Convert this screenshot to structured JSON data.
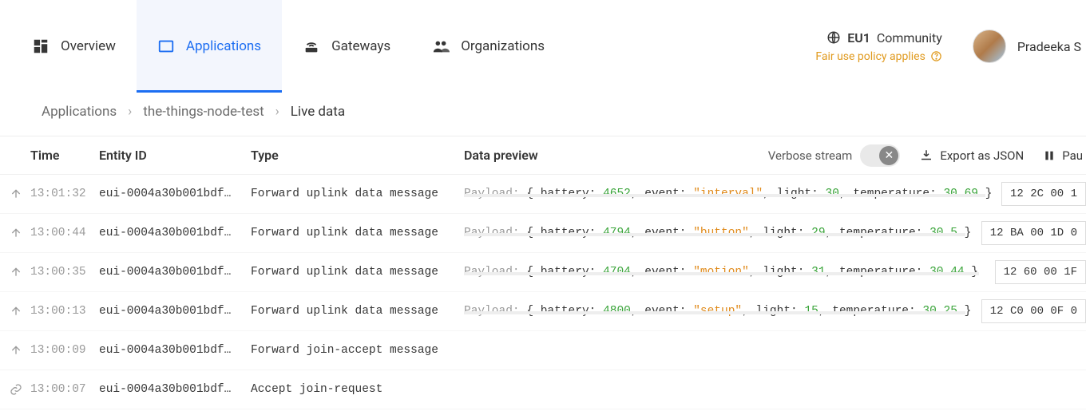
{
  "nav": {
    "overview": "Overview",
    "applications": "Applications",
    "gateways": "Gateways",
    "organizations": "Organizations"
  },
  "cluster": {
    "name": "EU1",
    "tag": "Community",
    "policy": "Fair use policy applies"
  },
  "user": {
    "name": "Pradeeka S"
  },
  "breadcrumb": {
    "root": "Applications",
    "app": "the-things-node-test",
    "page": "Live data"
  },
  "columns": {
    "time": "Time",
    "entity": "Entity ID",
    "type": "Type",
    "preview": "Data preview"
  },
  "controls": {
    "verbose": "Verbose stream",
    "export": "Export as JSON",
    "pause": "Pau"
  },
  "payload_label": "Payload:",
  "payload_keys": {
    "battery": "battery",
    "event": "event",
    "light": "light",
    "temperature": "temperature"
  },
  "entity_trunc": "eui-0004a30b001bdf…",
  "rows": [
    {
      "icon": "up",
      "time": "13:01:32",
      "type": "Forward uplink data message",
      "has_payload": true,
      "battery": "4652",
      "event": "\"interval\"",
      "light": "30",
      "temperature": "30.69",
      "hex": "12 2C 00 1"
    },
    {
      "icon": "up",
      "time": "13:00:44",
      "type": "Forward uplink data message",
      "has_payload": true,
      "battery": "4794",
      "event": "\"button\"",
      "light": "29",
      "temperature": "30.5",
      "hex": "12 BA 00 1D 0"
    },
    {
      "icon": "up",
      "time": "13:00:35",
      "type": "Forward uplink data message",
      "has_payload": true,
      "battery": "4704",
      "event": "\"motion\"",
      "light": "31",
      "temperature": "30.44",
      "hex": "12 60 00 1F"
    },
    {
      "icon": "up",
      "time": "13:00:13",
      "type": "Forward uplink data message",
      "has_payload": true,
      "battery": "4800",
      "event": "\"setup\"",
      "light": "15",
      "temperature": "30.25",
      "hex": "12 C0 00 0F 0"
    },
    {
      "icon": "up",
      "time": "13:00:09",
      "type": "Forward join-accept message",
      "has_payload": false
    },
    {
      "icon": "link",
      "time": "13:00:07",
      "type": "Accept join-request",
      "has_payload": false
    }
  ]
}
